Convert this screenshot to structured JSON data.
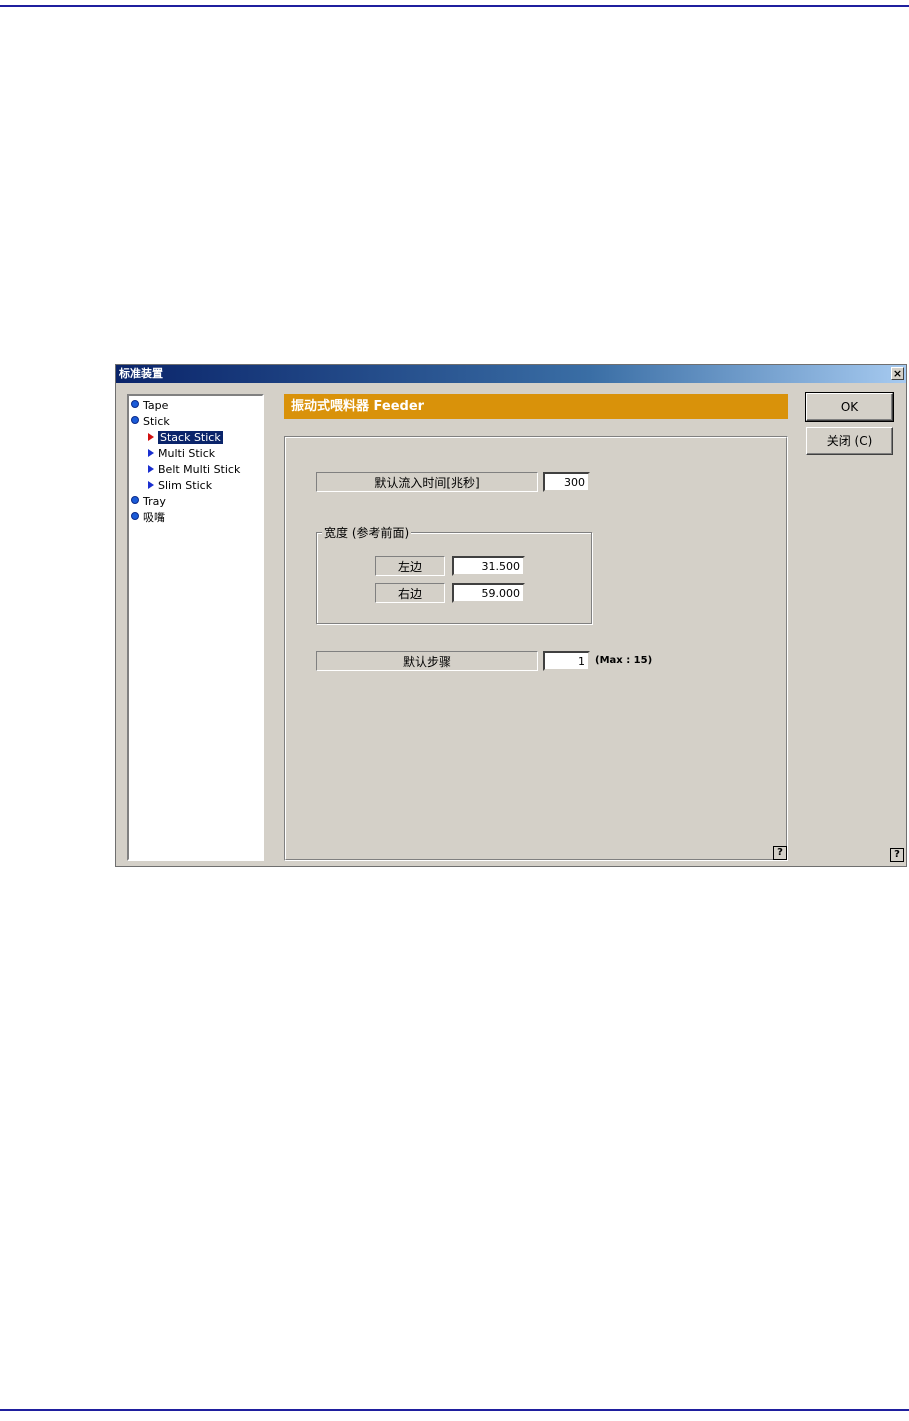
{
  "dialog": {
    "title": "标准装置",
    "close_glyph": "×"
  },
  "tree": {
    "items": [
      {
        "label": "Tape",
        "level": 0
      },
      {
        "label": "Stick",
        "level": 0
      },
      {
        "label": "Stack Stick",
        "level": 1,
        "selected": true
      },
      {
        "label": "Multi Stick",
        "level": 1
      },
      {
        "label": "Belt Multi Stick",
        "level": 1
      },
      {
        "label": "Slim Stick",
        "level": 1
      },
      {
        "label": "Tray",
        "level": 0
      },
      {
        "label": "吸嘴",
        "level": 0
      }
    ]
  },
  "header": {
    "title": "振动式喂料器 Feeder"
  },
  "form": {
    "infeed_time_label": "默认流入时间[兆秒]",
    "infeed_time_value": "300",
    "width_group_title": "宽度 (参考前面)",
    "left_label": "左边",
    "left_value": "31.500",
    "right_label": "右边",
    "right_value": "59.000",
    "steps_label": "默认步骤",
    "steps_value": "1",
    "steps_hint": "(Max : 15)"
  },
  "buttons": {
    "ok_label": "OK",
    "close_label": "关闭 (C)"
  },
  "help": {
    "glyph": "?"
  },
  "colors": {
    "header_orange": "#d9920a",
    "title_bar_start": "#0a246a",
    "title_bar_end": "#a6caf0",
    "window_bg": "#d4d0c8",
    "page_rule": "#1f1f9e"
  }
}
